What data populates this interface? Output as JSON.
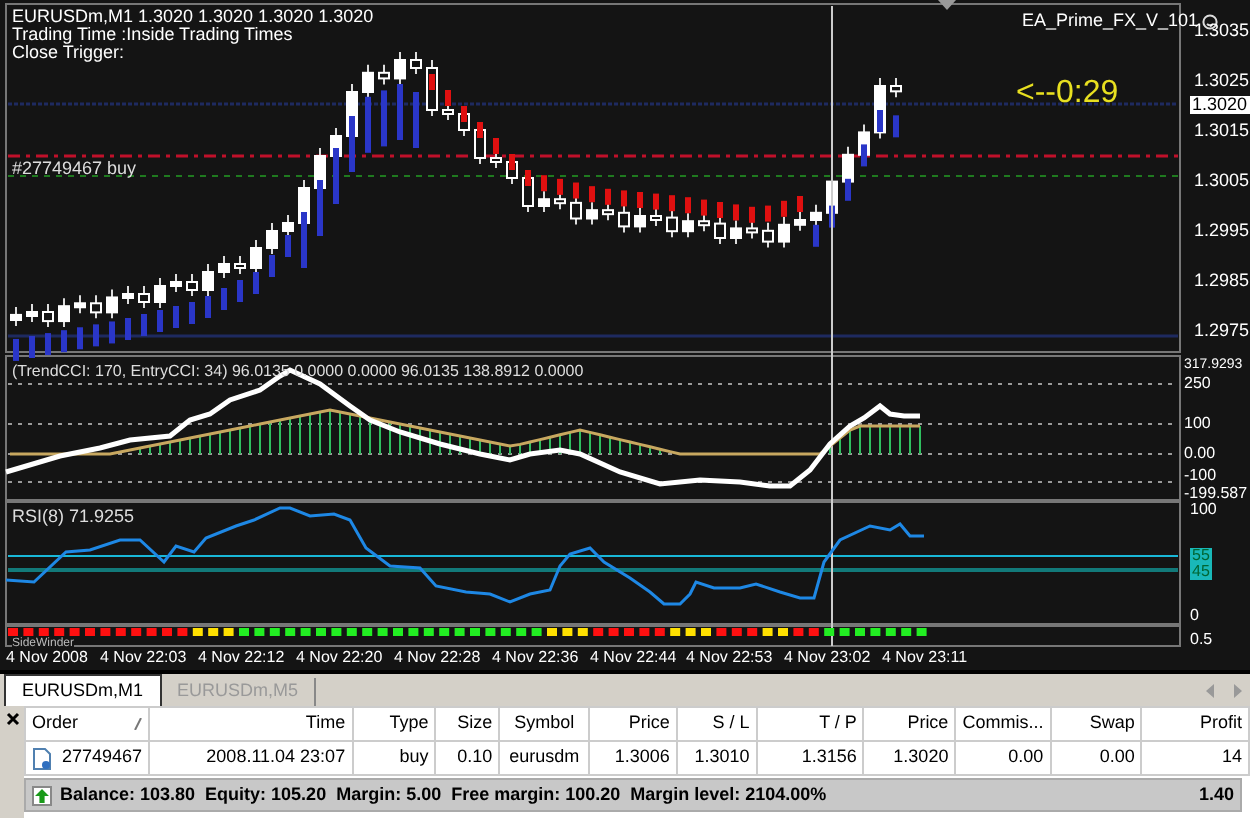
{
  "chart": {
    "header": "EURUSDm,M1  1.3020 1.3020 1.3020 1.3020",
    "info_lines": [
      "Trading Time :Inside Trading Times",
      "Close Trigger:"
    ],
    "order_label": "#27749467 buy",
    "expert": "EA_Prime_FX_V_101",
    "countdown": "<--0:29",
    "price_ticks": [
      "1.3035",
      "1.3025",
      "1.3015",
      "1.3005",
      "1.2995",
      "1.2985",
      "1.2975"
    ],
    "current_price": "1.3020"
  },
  "cci": {
    "label": "(TrendCCI: 170, EntryCCI: 34) 96.0135 0.0000 0.0000 96.0135 138.8912 0.0000",
    "ticks": [
      "317.9293",
      "250",
      "100",
      "0.00",
      "-100",
      "-199.587"
    ]
  },
  "rsi": {
    "label": "RSI(8) 71.9255",
    "ticks": [
      "100",
      "55",
      "45",
      "0"
    ]
  },
  "sidewinder": {
    "label": "SideWinder",
    "tick": "0.5"
  },
  "time_ticks": [
    "4 Nov 2008",
    "4 Nov 22:03",
    "4 Nov 22:12",
    "4 Nov 22:20",
    "4 Nov 22:28",
    "4 Nov 22:36",
    "4 Nov 22:44",
    "4 Nov 22:53",
    "4 Nov 23:02",
    "4 Nov 23:11"
  ],
  "tabs": [
    {
      "label": "EURUSDm,M1",
      "selected": true
    },
    {
      "label": "EURUSDm,M5",
      "selected": false
    }
  ],
  "table": {
    "columns": [
      "Order",
      "Time",
      "Type",
      "Size",
      "Symbol",
      "Price",
      "S / L",
      "T / P",
      "Price",
      "Commis...",
      "Swap",
      "Profit"
    ],
    "rows": [
      [
        "27749467",
        "2008.11.04 23:07",
        "buy",
        "0.10",
        "eurusdm",
        "1.3006",
        "1.3010",
        "1.3156",
        "1.3020",
        "0.00",
        "0.00",
        "14"
      ]
    ]
  },
  "status": {
    "summary": "Balance: 103.80  Equity: 105.20  Margin: 5.00  Free margin: 100.20  Margin level: 2104.00%",
    "profit": "1.40"
  }
}
